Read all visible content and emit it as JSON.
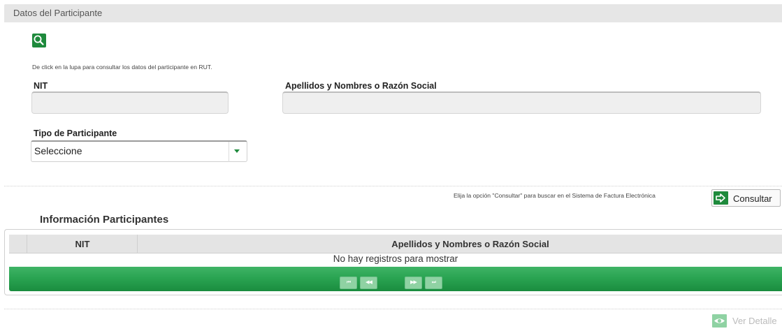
{
  "header": {
    "title": "Datos del Participante"
  },
  "lookup": {
    "icon": "search-icon",
    "hint": "De click en la lupa para consultar los datos del participante en RUT."
  },
  "form": {
    "nit_label": "NIT",
    "nit_value": "",
    "name_label": "Apellidos y Nombres o Razón Social",
    "name_value": "",
    "tipo_label": "Tipo de Participante",
    "tipo_selected": "Seleccione"
  },
  "search": {
    "hint": "Elija la opción \"Consultar\" para buscar en el Sistema de Factura Electrónica",
    "button_label": "Consultar",
    "button_icon": "arrow-right-icon"
  },
  "results": {
    "title": "Información Participantes",
    "columns": [
      "NIT",
      "Apellidos y Nombres o Razón Social"
    ],
    "empty_message": "No hay registros para mostrar",
    "pager": {
      "first": "⏮",
      "prev": "◀◀",
      "next": "▶▶",
      "last": "⏭"
    }
  },
  "detail": {
    "button_label": "Ver Detalle",
    "button_icon": "eye-icon"
  },
  "colors": {
    "accent": "#1e8a3c",
    "pager_green": "#2aa452",
    "header_gray": "#e6e6e6"
  }
}
